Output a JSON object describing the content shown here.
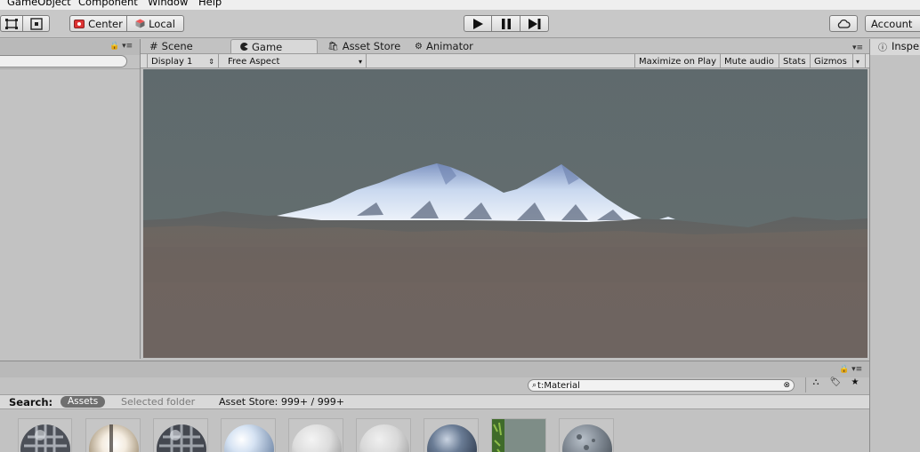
{
  "menu": [
    "GameObject",
    "Component",
    "Window",
    "Help"
  ],
  "toolbar": {
    "pivot_label": "Center",
    "rotation_label": "Local",
    "account_label": "Account"
  },
  "scene_tabs": [
    {
      "label": "Scene",
      "icon": "grid-icon"
    },
    {
      "label": "Game",
      "icon": "pacman-icon",
      "active": true
    },
    {
      "label": "Asset Store",
      "icon": "bag-icon"
    },
    {
      "label": "Animator",
      "icon": "animator-icon"
    }
  ],
  "game_toolbar": {
    "display": "Display 1",
    "aspect": "Free Aspect",
    "maximize": "Maximize on Play",
    "mute": "Mute audio",
    "stats": "Stats",
    "gizmos": "Gizmos"
  },
  "inspector": {
    "tab_label": "Inspe"
  },
  "project": {
    "search_value": "t:Material",
    "search_label": "Search:",
    "scope_assets": "Assets",
    "scope_selected": "Selected folder",
    "scope_store": "Asset Store: 999+ / 999+",
    "materials": [
      {
        "icon": "metal-sphere-icon"
      },
      {
        "icon": "highlight-sphere-icon"
      },
      {
        "icon": "metal-sphere-icon"
      },
      {
        "icon": "blue-sphere-icon"
      },
      {
        "icon": "white-sphere-icon"
      },
      {
        "icon": "white-sphere-icon"
      },
      {
        "icon": "dark-blue-sphere-icon"
      },
      {
        "icon": "grass-texture-icon"
      },
      {
        "icon": "rock-sphere-icon"
      }
    ]
  },
  "colors": {
    "sky": "#5f6b6e",
    "ground": "#6f6460",
    "snow": "#c8d8ee",
    "active_scope": "#6f6f6f"
  }
}
